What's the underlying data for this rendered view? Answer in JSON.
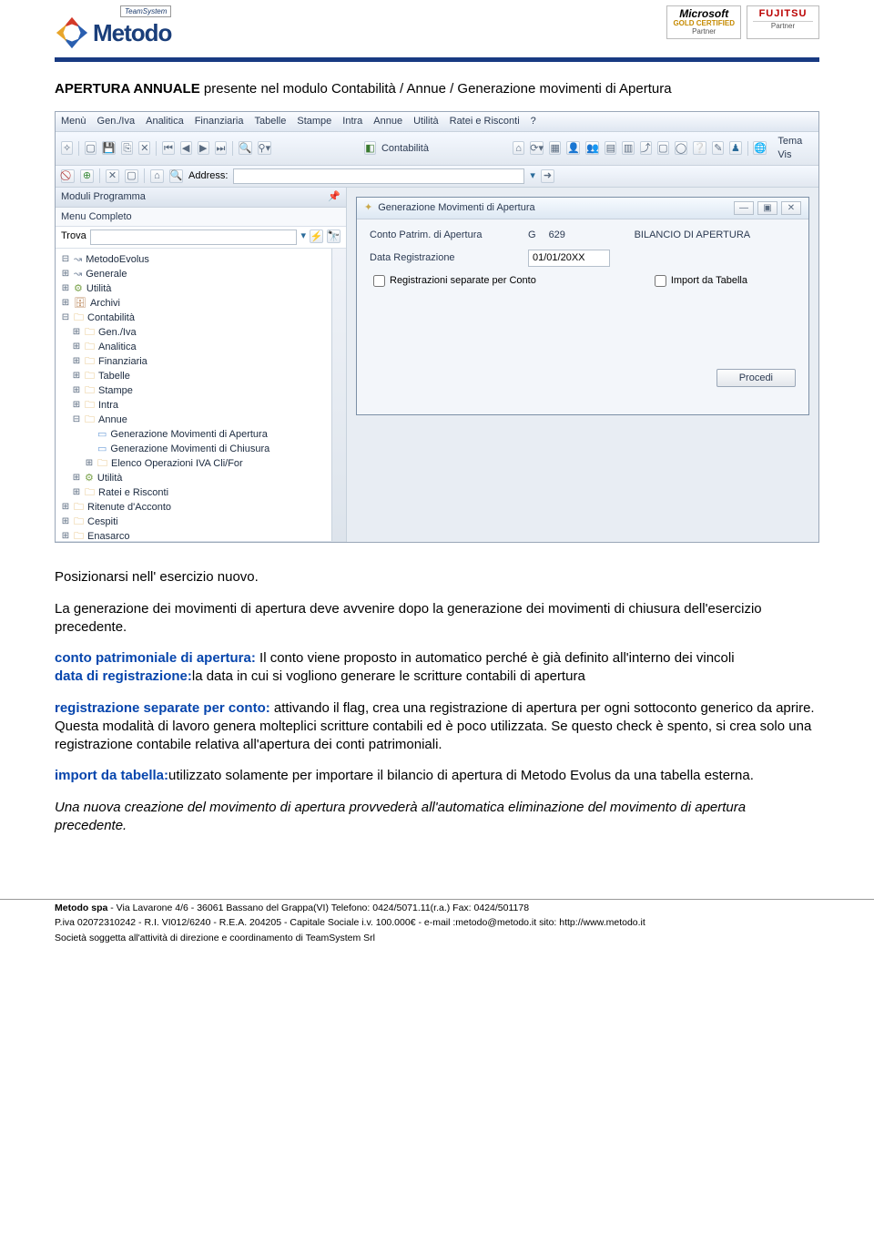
{
  "header": {
    "teamsystem": "TeamSystem",
    "brand": "Metodo",
    "badge1_line1": "Microsoft",
    "badge1_line2": "GOLD CERTIFIED",
    "badge1_line3": "Partner",
    "badge2_line1": "FUJITSU",
    "badge2_line2": "Partner"
  },
  "title_bold": "APERTURA ANNUALE",
  "title_rest": " presente nel modulo Contabilità / Annue / Generazione movimenti di Apertura",
  "screenshot": {
    "menus": [
      "Menù",
      "Gen./Iva",
      "Analitica",
      "Finanziaria",
      "Tabelle",
      "Stampe",
      "Intra",
      "Annue",
      "Utilità",
      "Ratei e Risconti",
      "?"
    ],
    "toolbar_label": "Contabilità",
    "toolbar_right": "Tema Vis",
    "address_label": "Address:",
    "sidebar_title": "Moduli Programma",
    "sidebar_sub": "Menu Completo",
    "search_label": "Trova",
    "tree": [
      {
        "depth": 0,
        "exp": "⊟",
        "icon": "~",
        "text": "MetodoEvolus"
      },
      {
        "depth": 0,
        "exp": "⊞",
        "icon": "~",
        "text": "Generale"
      },
      {
        "depth": 0,
        "exp": "⊞",
        "icon": "util",
        "text": "Utilità"
      },
      {
        "depth": 0,
        "exp": "⊞",
        "icon": "arch",
        "text": "Archivi"
      },
      {
        "depth": 0,
        "exp": "⊟",
        "icon": "folder",
        "text": "Contabilità"
      },
      {
        "depth": 1,
        "exp": "⊞",
        "icon": "folder",
        "text": "Gen./Iva"
      },
      {
        "depth": 1,
        "exp": "⊞",
        "icon": "folder",
        "text": "Analitica"
      },
      {
        "depth": 1,
        "exp": "⊞",
        "icon": "folder",
        "text": "Finanziaria"
      },
      {
        "depth": 1,
        "exp": "⊞",
        "icon": "folder",
        "text": "Tabelle"
      },
      {
        "depth": 1,
        "exp": "⊞",
        "icon": "folder",
        "text": "Stampe"
      },
      {
        "depth": 1,
        "exp": "⊞",
        "icon": "folder",
        "text": "Intra"
      },
      {
        "depth": 1,
        "exp": "⊟",
        "icon": "folder",
        "text": "Annue"
      },
      {
        "depth": 2,
        "exp": "",
        "icon": "doc",
        "text": "Generazione Movimenti di Apertura"
      },
      {
        "depth": 2,
        "exp": "",
        "icon": "doc",
        "text": "Generazione Movimenti di Chiusura"
      },
      {
        "depth": 2,
        "exp": "⊞",
        "icon": "folder",
        "text": "Elenco Operazioni IVA Cli/For"
      },
      {
        "depth": 1,
        "exp": "⊞",
        "icon": "util",
        "text": "Utilità"
      },
      {
        "depth": 1,
        "exp": "⊞",
        "icon": "folder",
        "text": "Ratei e Risconti"
      },
      {
        "depth": 0,
        "exp": "⊞",
        "icon": "folder",
        "text": "Ritenute d'Acconto"
      },
      {
        "depth": 0,
        "exp": "⊞",
        "icon": "folder",
        "text": "Cespiti"
      },
      {
        "depth": 0,
        "exp": "⊞",
        "icon": "folder",
        "text": "Enasarco"
      }
    ],
    "win_title": "Generazione Movimenti di Apertura",
    "field1_label": "Conto Patrim. di Apertura",
    "field1_prefix": "G",
    "field1_value": "629",
    "field1_desc": "BILANCIO DI APERTURA",
    "field2_label": "Data Registrazione",
    "field2_value": "01/01/20XX",
    "chk1": "Registrazioni separate per Conto",
    "chk2": "Import da Tabella",
    "button": "Procedi"
  },
  "body": {
    "p1": "Posizionarsi nell' esercizio nuovo.",
    "p2": "La generazione dei movimenti di apertura deve avvenire dopo la generazione dei movimenti di chiusura dell'esercizio precedente.",
    "p3a": "conto patrimoniale di apertura:",
    "p3b": " Il conto viene proposto in automatico perché è già definito all'interno dei vincoli",
    "p3c": "data di registrazione:",
    "p3d": "la data in cui si vogliono generare le scritture contabili di apertura",
    "p4a": "registrazione separate per conto:",
    "p4b": " attivando il flag, crea una registrazione di apertura per ogni sottoconto generico da aprire. Questa modalità di lavoro genera molteplici scritture contabili ed è poco utilizzata. Se questo check è spento, si crea solo una registrazione contabile relativa all'apertura dei conti patrimoniali.",
    "p5a": "import da tabella:",
    "p5b": "utilizzato solamente per importare il bilancio di apertura di Metodo Evolus da una tabella esterna.",
    "p6": "Una nuova creazione del movimento di apertura provvederà all'automatica eliminazione del movimento di apertura precedente."
  },
  "footer": {
    "l1a": "Metodo spa",
    "l1b": "  -   Via Lavarone 4/6 - 36061 Bassano del Grappa(VI) Telefono: 0424/5071.11(r.a.) Fax: 0424/501178",
    "l2": "P.iva 02072310242 - R.I. VI012/6240 - R.E.A. 204205 - Capitale Sociale i.v. 100.000€ - e-mail :metodo@metodo.it sito: http://www.metodo.it",
    "l3": "Società soggetta all'attività di direzione e coordinamento di TeamSystem Srl"
  }
}
